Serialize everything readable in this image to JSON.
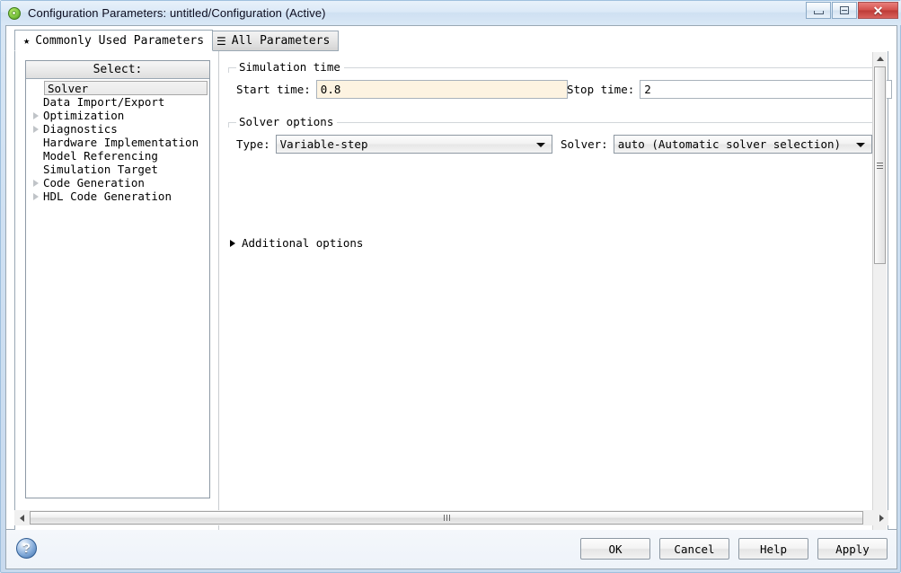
{
  "window": {
    "title": "Configuration Parameters: untitled/Configuration (Active)",
    "app_icon": "simulink-icon",
    "controls": {
      "minimize": "minimize-icon",
      "maximize": "maximize-icon",
      "close": "✕"
    }
  },
  "tabs": [
    {
      "label": "Commonly Used Parameters",
      "icon": "★",
      "active": true
    },
    {
      "label": "All Parameters",
      "icon": "☰",
      "active": false
    }
  ],
  "tree": {
    "header": "Select:",
    "items": [
      {
        "label": "Solver",
        "expandable": false,
        "selected": true
      },
      {
        "label": "Data Import/Export",
        "expandable": false,
        "selected": false
      },
      {
        "label": "Optimization",
        "expandable": true,
        "selected": false
      },
      {
        "label": "Diagnostics",
        "expandable": true,
        "selected": false
      },
      {
        "label": "Hardware Implementation",
        "expandable": false,
        "selected": false
      },
      {
        "label": "Model Referencing",
        "expandable": false,
        "selected": false
      },
      {
        "label": "Simulation Target",
        "expandable": false,
        "selected": false
      },
      {
        "label": "Code Generation",
        "expandable": true,
        "selected": false
      },
      {
        "label": "HDL Code Generation",
        "expandable": true,
        "selected": false
      }
    ]
  },
  "simulation_time": {
    "group_title": "Simulation time",
    "start_label": "Start time:",
    "start_value": "0.8",
    "start_edited": true,
    "stop_label": "Stop time:",
    "stop_value": "2"
  },
  "solver_options": {
    "group_title": "Solver options",
    "type_label": "Type:",
    "type_value": "Variable-step",
    "solver_label": "Solver:",
    "solver_value": "auto (Automatic solver selection)"
  },
  "additional_options": {
    "label": "Additional options",
    "expanded": false,
    "icon": "triangle-right-icon"
  },
  "footer": {
    "help_icon": "?",
    "buttons": [
      {
        "label": "OK",
        "name": "ok-button"
      },
      {
        "label": "Cancel",
        "name": "cancel-button"
      },
      {
        "label": "Help",
        "name": "help-button"
      },
      {
        "label": "Apply",
        "name": "apply-button"
      }
    ]
  },
  "colors": {
    "edited_field_bg": "#fdf3e1",
    "window_frame": "#c8daee",
    "close_button": "#d4514c",
    "panel_border": "#9aa8b4"
  }
}
